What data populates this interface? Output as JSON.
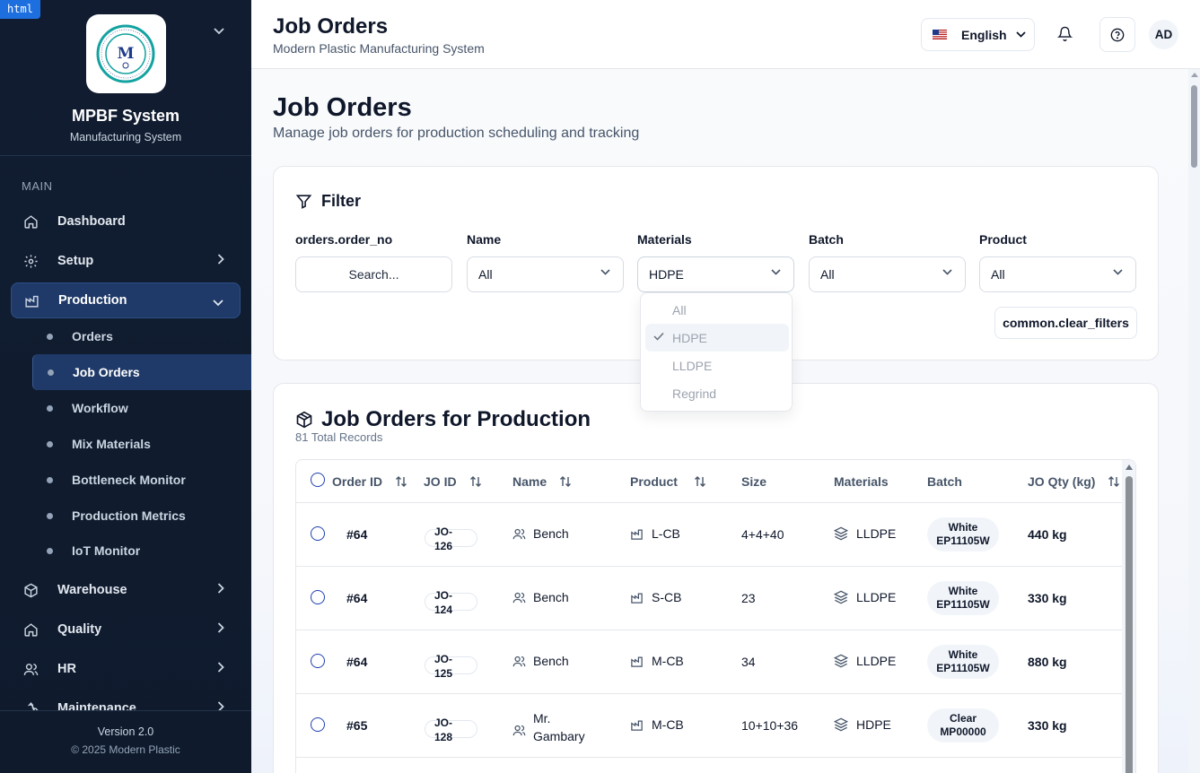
{
  "badge": "html",
  "brand": {
    "title": "MPBF System",
    "subtitle": "Manufacturing System",
    "logo_text": "MODERN PLASTIC BAG FACTORY"
  },
  "nav": {
    "section": "MAIN",
    "items": [
      {
        "label": "Dashboard",
        "icon": "home-icon"
      },
      {
        "label": "Setup",
        "icon": "gear-icon"
      },
      {
        "label": "Production",
        "icon": "factory-icon"
      },
      {
        "label": "Warehouse",
        "icon": "box-icon"
      },
      {
        "label": "Quality",
        "icon": "home-icon"
      },
      {
        "label": "HR",
        "icon": "users-icon"
      },
      {
        "label": "Maintenance",
        "icon": "wrench-icon"
      }
    ],
    "production_sub": [
      "Orders",
      "Job Orders",
      "Workflow",
      "Mix Materials",
      "Bottleneck Monitor",
      "Production Metrics",
      "IoT Monitor"
    ]
  },
  "footer": {
    "version": "Version 2.0",
    "copyright": "© 2025 Modern Plastic"
  },
  "header": {
    "title": "Job Orders",
    "subtitle": "Modern Plastic Manufacturing System",
    "language": "English",
    "avatar": "AD"
  },
  "page": {
    "title": "Job Orders",
    "subtitle": "Manage job orders for production scheduling and tracking"
  },
  "filter": {
    "title": "Filter",
    "order_no_label": "orders.order_no",
    "search_placeholder": "Search...",
    "name_label": "Name",
    "name_value": "All",
    "materials_label": "Materials",
    "materials_value": "HDPE",
    "batch_label": "Batch",
    "batch_value": "All",
    "product_label": "Product",
    "product_value": "All",
    "clear_label": "common.clear_filters",
    "materials_options": [
      "All",
      "HDPE",
      "LLDPE",
      "Regrind"
    ],
    "materials_selected": "HDPE"
  },
  "jobs": {
    "title": "Job Orders for Production",
    "count": "81 Total Records",
    "columns": [
      "Order ID",
      "JO ID",
      "Name",
      "Product",
      "Size",
      "Materials",
      "Batch",
      "JO Qty (kg)"
    ],
    "rows": [
      {
        "order": "#64",
        "jo1": "JO-",
        "jo2": "126",
        "name1": "Bench",
        "name2": "",
        "product": "L-CB",
        "size": "4+4+40",
        "material": "LLDPE",
        "batch1": "White",
        "batch2": "EP11105W",
        "qty": "440 kg"
      },
      {
        "order": "#64",
        "jo1": "JO-",
        "jo2": "124",
        "name1": "Bench",
        "name2": "",
        "product": "S-CB",
        "size": "23",
        "material": "LLDPE",
        "batch1": "White",
        "batch2": "EP11105W",
        "qty": "330 kg"
      },
      {
        "order": "#64",
        "jo1": "JO-",
        "jo2": "125",
        "name1": "Bench",
        "name2": "",
        "product": "M-CB",
        "size": "34",
        "material": "LLDPE",
        "batch1": "White",
        "batch2": "EP11105W",
        "qty": "880 kg"
      },
      {
        "order": "#65",
        "jo1": "JO-",
        "jo2": "128",
        "name1": "Mr.",
        "name2": "Gambary",
        "product": "M-CB",
        "size": "10+10+36",
        "material": "HDPE",
        "batch1": "Clear",
        "batch2": "MP00000",
        "qty": "330 kg"
      }
    ]
  },
  "colors": {
    "sidebar": "#111c30",
    "active": "#1f3a68",
    "radio": "#1e40af"
  }
}
